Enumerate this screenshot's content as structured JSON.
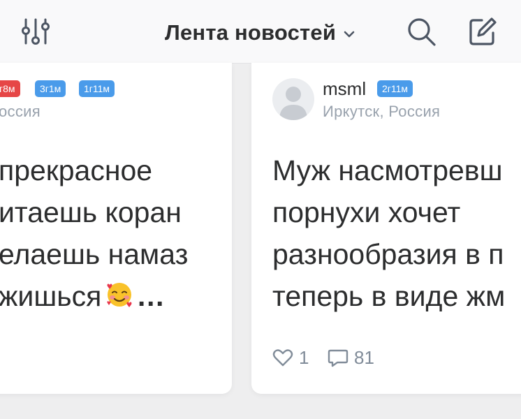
{
  "header": {
    "title": "Лента новостей",
    "icons": [
      "filter-sliders-icon",
      "chevron-down-icon",
      "search-icon",
      "compose-icon"
    ]
  },
  "posts": [
    {
      "badges": [
        "г8м",
        "3г1м",
        "1г11м"
      ],
      "location": "оссия",
      "text_lines": [
        "прекрасное",
        "итаешь коран",
        "елаешь намаз",
        "жишься"
      ],
      "emoji": "smiling-face-with-hearts",
      "more": "…"
    },
    {
      "username": "msml",
      "badge": "2г11м",
      "location": "Иркутск, Россия",
      "text_lines": [
        "Муж насмотревш",
        "порнухи хочет",
        "разнообразия в п",
        "теперь в виде жм"
      ],
      "likes": "1",
      "comments": "81"
    }
  ],
  "colors": {
    "accent": "#4a9bea",
    "badge_red": "#e64646",
    "text": "#2c2d2e",
    "secondary": "#99a2ad",
    "icon": "#4c5563"
  }
}
